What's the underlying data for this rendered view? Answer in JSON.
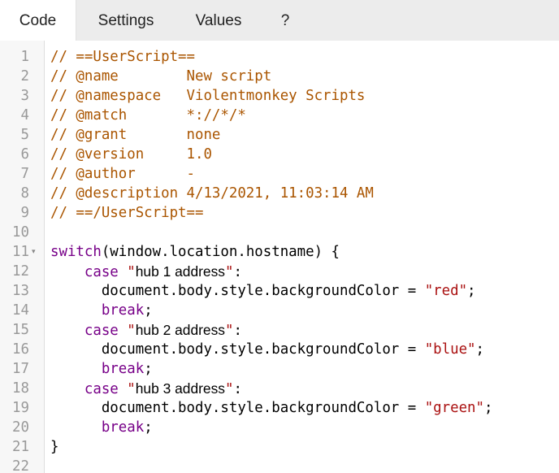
{
  "tabs": [
    {
      "label": "Code",
      "active": true
    },
    {
      "label": "Settings",
      "active": false
    },
    {
      "label": "Values",
      "active": false
    },
    {
      "label": "?",
      "active": false
    }
  ],
  "editor": {
    "fold_marker": "▾",
    "lines": [
      {
        "num": "1",
        "tokens": [
          {
            "t": "comment",
            "v": "// ==UserScript=="
          }
        ]
      },
      {
        "num": "2",
        "tokens": [
          {
            "t": "comment",
            "v": "// @name        New script"
          }
        ]
      },
      {
        "num": "3",
        "tokens": [
          {
            "t": "comment",
            "v": "// @namespace   Violentmonkey Scripts"
          }
        ]
      },
      {
        "num": "4",
        "tokens": [
          {
            "t": "comment",
            "v": "// @match       *://*/*"
          }
        ]
      },
      {
        "num": "5",
        "tokens": [
          {
            "t": "comment",
            "v": "// @grant       none"
          }
        ]
      },
      {
        "num": "6",
        "tokens": [
          {
            "t": "comment",
            "v": "// @version     1.0"
          }
        ]
      },
      {
        "num": "7",
        "tokens": [
          {
            "t": "comment",
            "v": "// @author      -"
          }
        ]
      },
      {
        "num": "8",
        "tokens": [
          {
            "t": "comment",
            "v": "// @description 4/13/2021, 11:03:14 AM"
          }
        ]
      },
      {
        "num": "9",
        "tokens": [
          {
            "t": "comment",
            "v": "// ==/UserScript=="
          }
        ]
      },
      {
        "num": "10",
        "tokens": []
      },
      {
        "num": "11",
        "fold": true,
        "tokens": [
          {
            "t": "keyword",
            "v": "switch"
          },
          {
            "t": "plain",
            "v": "(window.location.hostname) {"
          }
        ]
      },
      {
        "num": "12",
        "tokens": [
          {
            "t": "plain",
            "v": "    "
          },
          {
            "t": "keyword",
            "v": "case"
          },
          {
            "t": "plain",
            "v": " "
          },
          {
            "t": "string",
            "v": "\""
          },
          {
            "t": "sans",
            "v": "hub 1 address"
          },
          {
            "t": "string",
            "v": "\""
          },
          {
            "t": "plain",
            "v": ":"
          }
        ]
      },
      {
        "num": "13",
        "tokens": [
          {
            "t": "plain",
            "v": "      document.body.style.backgroundColor = "
          },
          {
            "t": "string",
            "v": "\"red\""
          },
          {
            "t": "plain",
            "v": ";"
          }
        ]
      },
      {
        "num": "14",
        "tokens": [
          {
            "t": "plain",
            "v": "      "
          },
          {
            "t": "keyword",
            "v": "break"
          },
          {
            "t": "plain",
            "v": ";"
          }
        ]
      },
      {
        "num": "15",
        "tokens": [
          {
            "t": "plain",
            "v": "    "
          },
          {
            "t": "keyword",
            "v": "case"
          },
          {
            "t": "plain",
            "v": " "
          },
          {
            "t": "string",
            "v": "\""
          },
          {
            "t": "sans",
            "v": "hub 2 address"
          },
          {
            "t": "string",
            "v": "\""
          },
          {
            "t": "plain",
            "v": ":"
          }
        ]
      },
      {
        "num": "16",
        "tokens": [
          {
            "t": "plain",
            "v": "      document.body.style.backgroundColor = "
          },
          {
            "t": "string",
            "v": "\"blue\""
          },
          {
            "t": "plain",
            "v": ";"
          }
        ]
      },
      {
        "num": "17",
        "tokens": [
          {
            "t": "plain",
            "v": "      "
          },
          {
            "t": "keyword",
            "v": "break"
          },
          {
            "t": "plain",
            "v": ";"
          }
        ]
      },
      {
        "num": "18",
        "tokens": [
          {
            "t": "plain",
            "v": "    "
          },
          {
            "t": "keyword",
            "v": "case"
          },
          {
            "t": "plain",
            "v": " "
          },
          {
            "t": "string",
            "v": "\""
          },
          {
            "t": "sans",
            "v": "hub 3 address"
          },
          {
            "t": "string",
            "v": "\""
          },
          {
            "t": "plain",
            "v": ":"
          }
        ]
      },
      {
        "num": "19",
        "tokens": [
          {
            "t": "plain",
            "v": "      document.body.style.backgroundColor = "
          },
          {
            "t": "string",
            "v": "\"green\""
          },
          {
            "t": "plain",
            "v": ";"
          }
        ]
      },
      {
        "num": "20",
        "tokens": [
          {
            "t": "plain",
            "v": "      "
          },
          {
            "t": "keyword",
            "v": "break"
          },
          {
            "t": "plain",
            "v": ";"
          }
        ]
      },
      {
        "num": "21",
        "tokens": [
          {
            "t": "plain",
            "v": "}"
          }
        ]
      },
      {
        "num": "22",
        "tokens": []
      }
    ]
  },
  "colors": {
    "comment": "#aa5500",
    "keyword": "#770088",
    "string": "#aa1111",
    "plain": "#000000",
    "tabbar_bg": "#ececec",
    "gutter_bg": "#f7f7f7"
  }
}
